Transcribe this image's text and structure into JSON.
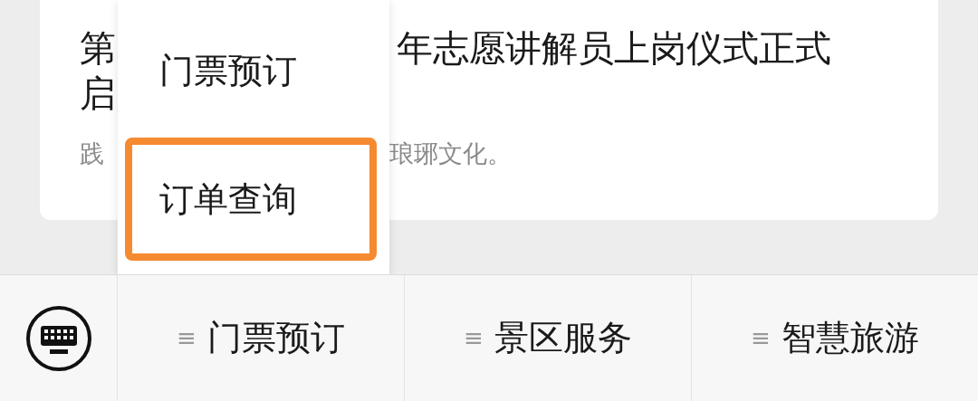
{
  "article": {
    "title_line1": [
      "第",
      "年志愿讲解员上岗仪式正式"
    ],
    "title_line2": "启",
    "summary": [
      "践",
      "琅琊文化。"
    ]
  },
  "popup_menu": {
    "items": [
      {
        "label": "门票预订",
        "highlighted": false
      },
      {
        "label": "订单查询",
        "highlighted": true
      }
    ]
  },
  "bottom_menu": {
    "items": [
      {
        "icon": "≡",
        "label": "门票预订"
      },
      {
        "icon": "≡",
        "label": "景区服务"
      },
      {
        "icon": "≡",
        "label": "智慧旅游"
      }
    ]
  }
}
